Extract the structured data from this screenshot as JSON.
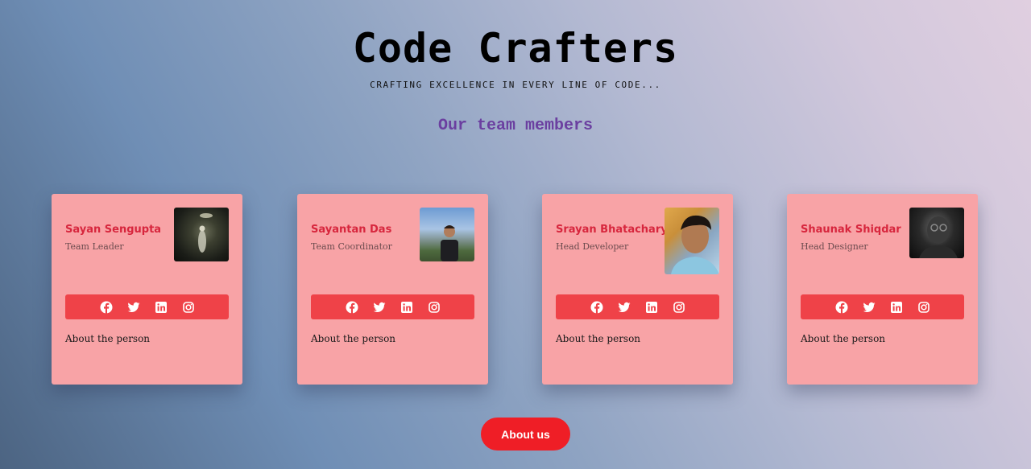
{
  "header": {
    "title": "Code Crafters",
    "tagline": "CRAFTING EXCELLENCE IN EVERY LINE OF CODE...",
    "subtitle": "Our team members"
  },
  "cards": [
    {
      "name": "Sayan Sengupta",
      "role": "Team Leader",
      "about": "About the person"
    },
    {
      "name": "Sayantan Das",
      "role": "Team Coordinator",
      "about": "About the person"
    },
    {
      "name": "Srayan Bhatacharya",
      "role": "Head Developer",
      "about": "About the person"
    },
    {
      "name": "Shaunak Shiqdar",
      "role": "Head Designer",
      "about": "About the person"
    }
  ],
  "social_icons": [
    "facebook-icon",
    "twitter-icon",
    "linkedin-icon",
    "instagram-icon"
  ],
  "about_button_label": "About us",
  "colors": {
    "card_bg": "#f8a3a6",
    "name_color": "#d7263d",
    "social_bar": "#ef4248",
    "subtitle": "#6b3fa0",
    "button": "#ef1e26"
  }
}
